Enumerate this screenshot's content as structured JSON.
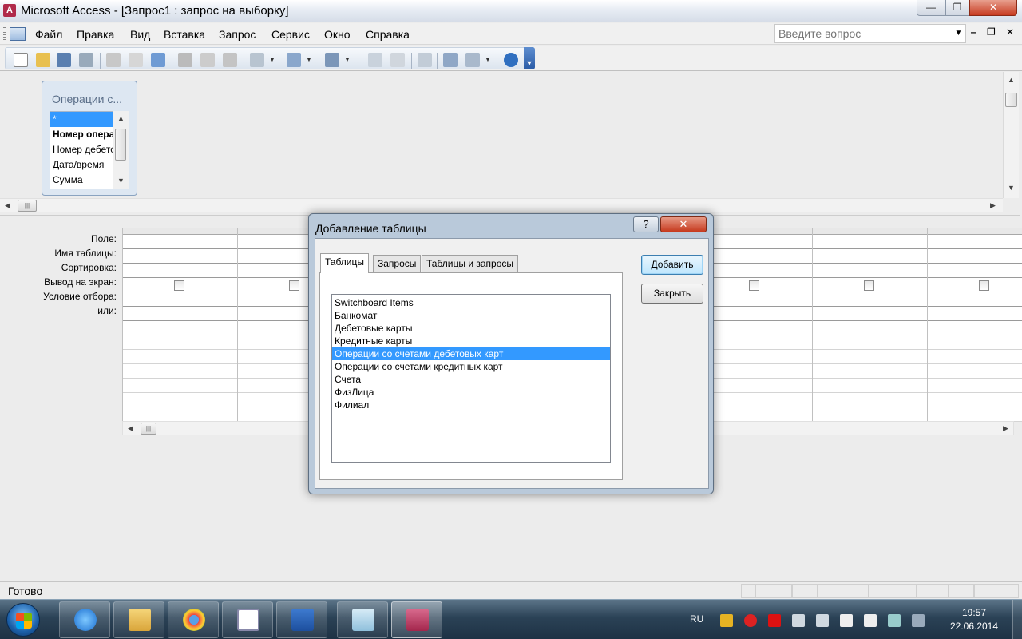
{
  "window": {
    "app_name": "Microsoft Access",
    "title": "Microsoft Access - [Запрос1 : запрос на выборку]",
    "min_symbol": "—",
    "max_symbol": "❐",
    "close_symbol": "✕"
  },
  "menu": {
    "items": [
      {
        "label": "Файл"
      },
      {
        "label": "Правка"
      },
      {
        "label": "Вид"
      },
      {
        "label": "Вставка"
      },
      {
        "label": "Запрос"
      },
      {
        "label": "Сервис"
      },
      {
        "label": "Окно"
      },
      {
        "label": "Справка"
      }
    ],
    "ask_placeholder": "Введите вопрос",
    "mdi_min": "‒",
    "mdi_restore": "❐",
    "mdi_close": "✕"
  },
  "toolbar": {
    "icons": [
      "new-icon",
      "open-icon",
      "save-icon",
      "search-icon",
      "print-icon",
      "print-preview-icon",
      "spelling-icon",
      "cut-icon",
      "copy-icon",
      "paste-icon",
      "undo-icon",
      "query-type-icon",
      "run-icon",
      "show-table-icon",
      "totals-icon",
      "properties-icon",
      "build-icon",
      "database-window-icon",
      "new-object-icon",
      "help-icon"
    ]
  },
  "field_list": {
    "title": "Операции с...",
    "fields": [
      "*",
      "Номер операции",
      "Номер дебетовой карты",
      "Дата/время",
      "Сумма"
    ]
  },
  "grid": {
    "row_labels": [
      "Поле:",
      "Имя таблицы:",
      "Сортировка:",
      "Вывод на экран:",
      "Условие отбора:",
      "или:"
    ],
    "columns": 8
  },
  "dialog": {
    "title": "Добавление таблицы",
    "help_symbol": "?",
    "close_symbol": "✕",
    "tabs": [
      "Таблицы",
      "Запросы",
      "Таблицы и запросы"
    ],
    "tables": [
      "Switchboard Items",
      "Банкомат",
      "Дебетовые карты",
      "Кредитные карты",
      "Операции со счетами дебетовых карт",
      "Операции со счетами кредитных карт",
      "Счета",
      "ФизЛица",
      "Филиал"
    ],
    "selected_index": 4,
    "add_button": "Добавить",
    "close_button": "Закрыть"
  },
  "status": {
    "text": "Готово"
  },
  "taskbar": {
    "apps": [
      "internet-explorer-icon",
      "explorer-icon",
      "chrome-icon",
      "calendar-icon",
      "word-icon",
      "notepad-icon",
      "access-icon"
    ],
    "language": "RU",
    "time": "19:57",
    "date": "22.06.2014"
  },
  "colors": {
    "selection": "#3399ff",
    "dialog_frame": "#b9c9da",
    "close_red": "#c63a1e"
  }
}
